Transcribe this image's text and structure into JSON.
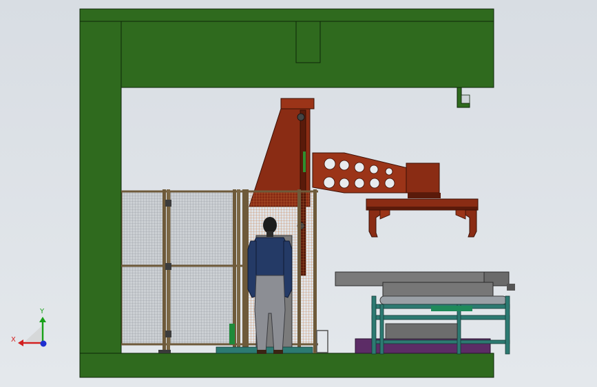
{
  "view": {
    "background_color": "#dde1e6"
  },
  "triad": {
    "x_label": "X",
    "y_label": "Y",
    "x_color": "#d21f1f",
    "y_color": "#18a018",
    "z_color": "#1e2fd0"
  },
  "colors": {
    "frame_green": "#2f6a1e",
    "frame_outline": "#0e2508",
    "robot_brown": "#8a2c14",
    "robot_outline": "#3a0f05",
    "fence_post": "#6e5a3a",
    "machine_grey": "#7a7a7a",
    "machine_teal": "#2d7a72"
  },
  "scene": {
    "objects": [
      {
        "name": "portal-frame",
        "label": ""
      },
      {
        "name": "gantry-robot",
        "label": ""
      },
      {
        "name": "safety-fence",
        "label": ""
      },
      {
        "name": "operator-figure",
        "label": ""
      },
      {
        "name": "conveyor-station",
        "label": ""
      }
    ]
  }
}
